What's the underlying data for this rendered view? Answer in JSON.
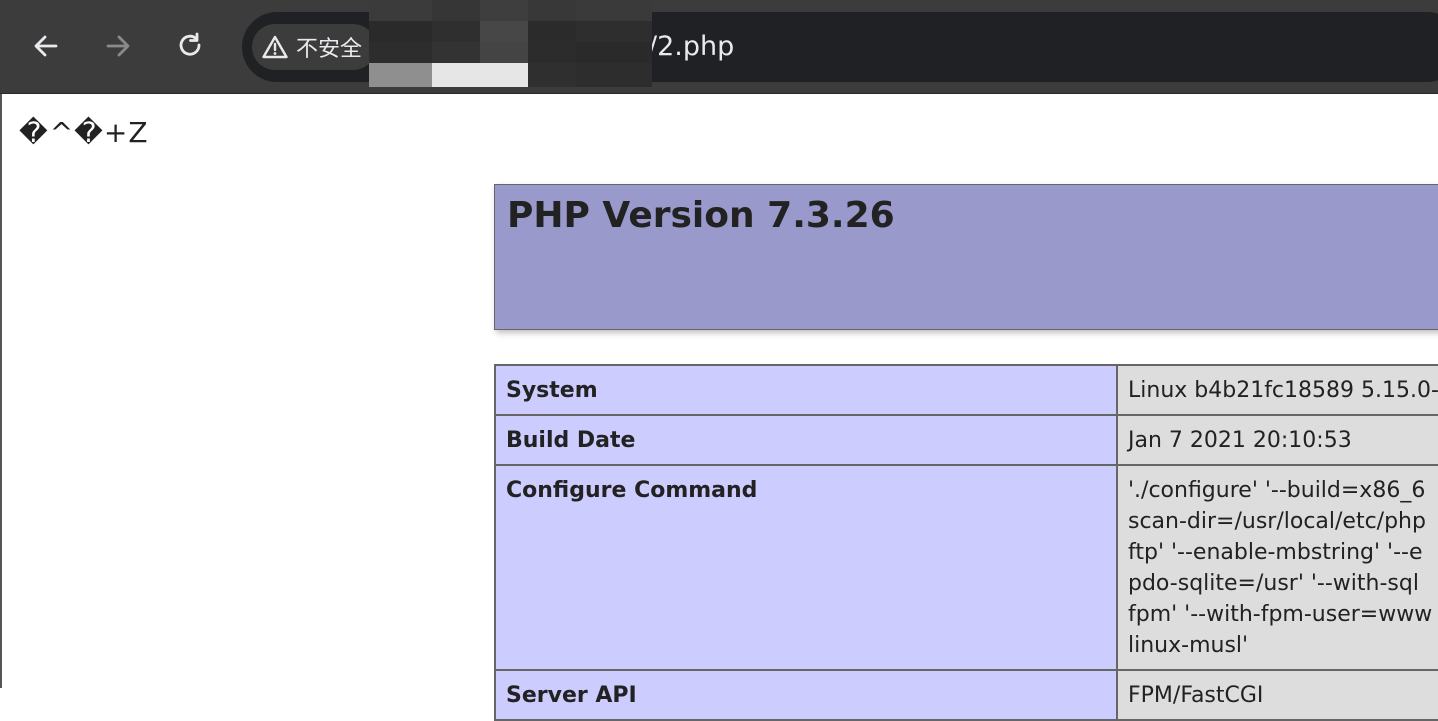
{
  "browser": {
    "security_label": "不安全",
    "url_visible": "/2.php"
  },
  "page": {
    "garbage_text": "�\u0010^�+Z",
    "php_title": "PHP Version 7.3.26",
    "rows": [
      {
        "key": "System",
        "value_lines": [
          "Linux b4b21fc18589 5.15.0-"
        ]
      },
      {
        "key": "Build Date",
        "value_lines": [
          "Jan 7 2021 20:10:53"
        ]
      },
      {
        "key": "Configure Command",
        "value_lines": [
          "'./configure' '--build=x86_6",
          "scan-dir=/usr/local/etc/php",
          "ftp' '--enable-mbstring' '--e",
          "pdo-sqlite=/usr' '--with-sql",
          "fpm' '--with-fpm-user=www",
          "linux-musl'"
        ]
      },
      {
        "key": "Server API",
        "value_lines": [
          "FPM/FastCGI"
        ]
      }
    ]
  },
  "colors": {
    "php_header_bg": "#9999cc",
    "key_cell_bg": "#ccccff",
    "value_cell_bg": "#dddddd",
    "chrome_bg": "#3c3c3c"
  },
  "icons": {
    "back": "back-arrow-icon",
    "forward": "forward-arrow-icon",
    "reload": "reload-icon",
    "warning": "warning-triangle-icon"
  }
}
